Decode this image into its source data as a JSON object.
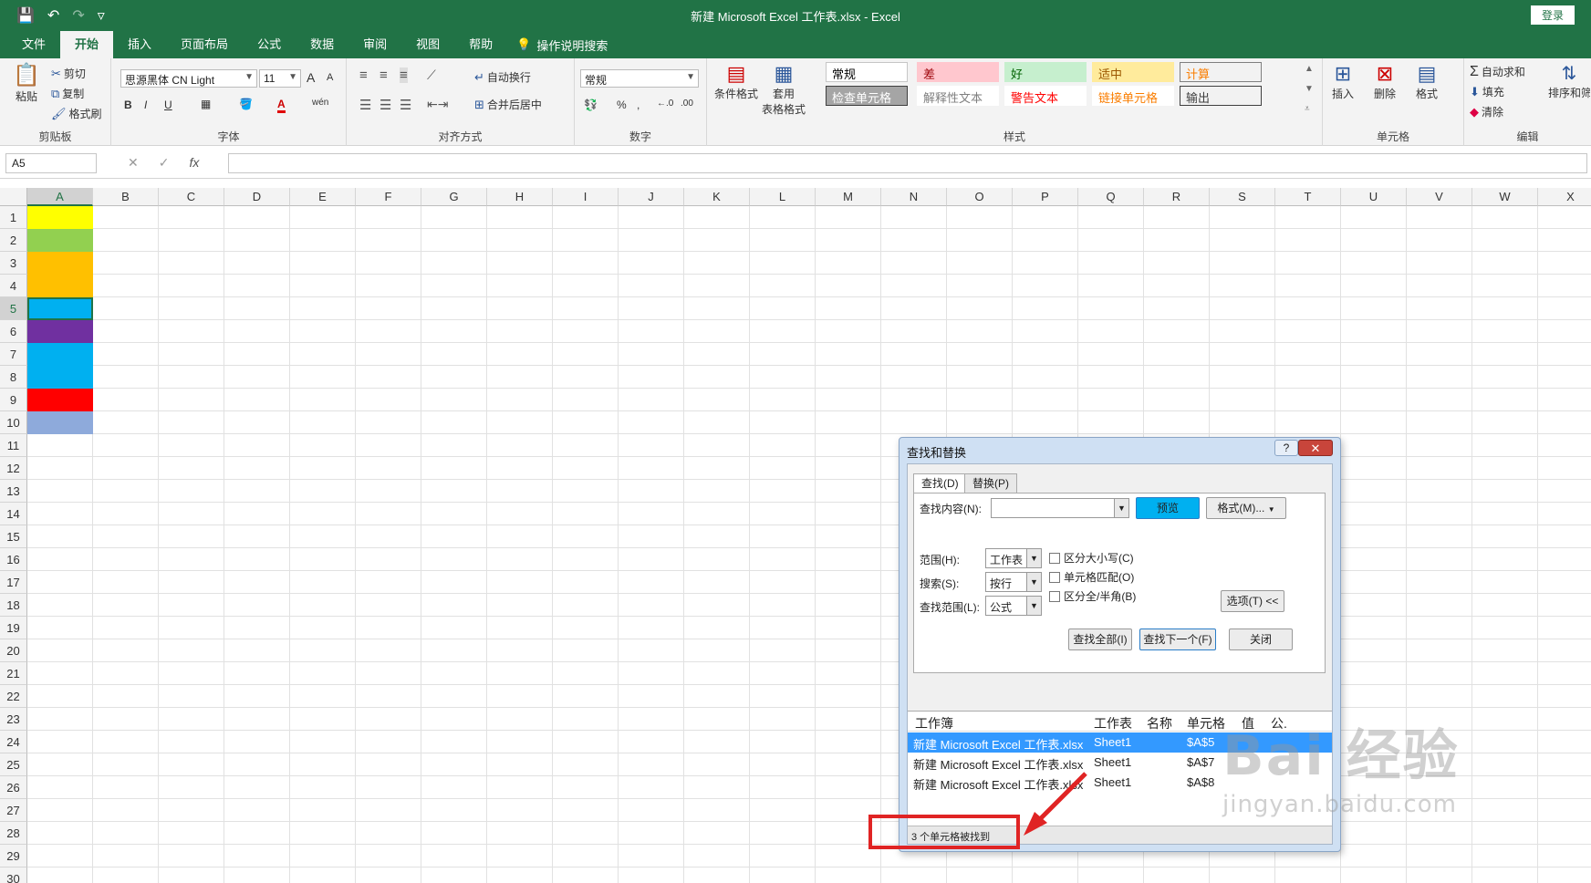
{
  "titlebar": {
    "title": "新建 Microsoft Excel 工作表.xlsx  -  Excel",
    "login": "登录",
    "save_icon": "💾",
    "undo_icon": "↶",
    "redo_icon": "↷",
    "customize_icon": "▿"
  },
  "tabs": [
    "文件",
    "开始",
    "插入",
    "页面布局",
    "公式",
    "数据",
    "审阅",
    "视图",
    "帮助"
  ],
  "tellme": "操作说明搜索",
  "ribbon": {
    "clipboard": {
      "label": "剪贴板",
      "paste": "粘贴",
      "cut": "剪切",
      "copy": "复制",
      "format_painter": "格式刷"
    },
    "font": {
      "label": "字体",
      "name": "思源黑体 CN Light",
      "size": "11",
      "grow": "A",
      "shrink": "A",
      "bold": "B",
      "italic": "I",
      "underline": "U",
      "font_color": "A",
      "phonetic": "wén"
    },
    "alignment": {
      "label": "对齐方式",
      "wrap": "自动换行",
      "merge": "合并后居中"
    },
    "number": {
      "label": "数字",
      "format": "常规",
      "percent": "%",
      "comma": ","
    },
    "styles": {
      "label": "样式",
      "cond_format": "条件格式",
      "table_format_1": "套用",
      "table_format_2": "表格格式",
      "items": [
        {
          "text": "常规",
          "bg": "#ffffff",
          "fg": "#000000",
          "border": "#c6c6c6"
        },
        {
          "text": "差",
          "bg": "#ffc7ce",
          "fg": "#9c0006",
          "border": "#ffc7ce"
        },
        {
          "text": "好",
          "bg": "#c6efce",
          "fg": "#006100",
          "border": "#c6efce"
        },
        {
          "text": "适中",
          "bg": "#ffeb9c",
          "fg": "#9c5700",
          "border": "#ffeb9c"
        },
        {
          "text": "计算",
          "bg": "#f2f2f2",
          "fg": "#fa7d00",
          "border": "#7f7f7f"
        },
        {
          "text": "检查单元格",
          "bg": "#a5a5a5",
          "fg": "#ffffff",
          "border": "#3f3f3f"
        },
        {
          "text": "解释性文本",
          "bg": "#ffffff",
          "fg": "#7f7f7f",
          "border": "#ffffff"
        },
        {
          "text": "警告文本",
          "bg": "#ffffff",
          "fg": "#ff0000",
          "border": "#ffffff"
        },
        {
          "text": "链接单元格",
          "bg": "#ffffff",
          "fg": "#fa7d00",
          "border": "#ffffff"
        },
        {
          "text": "输出",
          "bg": "#f2f2f2",
          "fg": "#3f3f3f",
          "border": "#3f3f3f"
        }
      ]
    },
    "cells": {
      "label": "单元格",
      "insert": "插入",
      "delete": "删除",
      "format": "格式"
    },
    "editing": {
      "label": "编辑",
      "autosum": "自动求和",
      "fill": "填充",
      "clear": "清除",
      "sort": "排序和筛"
    }
  },
  "formula_bar": {
    "name_box": "A5",
    "cancel": "✕",
    "enter": "✓",
    "fx": "fx",
    "value": ""
  },
  "columns": [
    "A",
    "B",
    "C",
    "D",
    "E",
    "F",
    "G",
    "H",
    "I",
    "J",
    "K",
    "L",
    "M",
    "N",
    "O",
    "P",
    "Q",
    "R",
    "S",
    "T",
    "U",
    "V",
    "W",
    "X"
  ],
  "rows": [
    "1",
    "2",
    "3",
    "4",
    "5",
    "6",
    "7",
    "8",
    "9",
    "10",
    "11",
    "12",
    "13",
    "14",
    "15",
    "16",
    "17",
    "18",
    "19",
    "20",
    "21",
    "22",
    "23",
    "24",
    "25",
    "26",
    "27",
    "28",
    "29",
    "30"
  ],
  "column_a_colors": [
    "#ffff00",
    "#92d050",
    "#ffc000",
    "#ffc000",
    "#00b0f0",
    "#7030a0",
    "#00b0f0",
    "#00b0f0",
    "#ff0000",
    "#8eaadb"
  ],
  "selected_cell": "A5",
  "dialog": {
    "title": "查找和替换",
    "help": "?",
    "close": "✕",
    "tab_find": "查找(D)",
    "tab_replace": "替换(P)",
    "find_label": "查找内容(N):",
    "find_value": "",
    "preview": "预览",
    "preview_bg": "#00b0f0",
    "format_btn": "格式(M)...",
    "within_label": "范围(H):",
    "within_value": "工作表",
    "search_label": "搜索(S):",
    "search_value": "按行",
    "lookin_label": "查找范围(L):",
    "lookin_value": "公式",
    "match_case": "区分大小写(C)",
    "match_entire": "单元格匹配(O)",
    "match_byte": "区分全/半角(B)",
    "options_btn": "选项(T) <<",
    "find_all": "查找全部(I)",
    "find_next": "查找下一个(F)",
    "close_btn": "关闭",
    "result_headers": [
      "工作簿",
      "工作表",
      "名称",
      "单元格",
      "值",
      "公."
    ],
    "results": [
      {
        "book": "新建 Microsoft Excel 工作表.xlsx",
        "sheet": "Sheet1",
        "cell": "$A$5"
      },
      {
        "book": "新建 Microsoft Excel 工作表.xlsx",
        "sheet": "Sheet1",
        "cell": "$A$7"
      },
      {
        "book": "新建 Microsoft Excel 工作表.xlsx",
        "sheet": "Sheet1",
        "cell": "$A$8"
      }
    ],
    "status": "3 个单元格被找到"
  },
  "annotation": {
    "color": "#e02424"
  },
  "watermark": {
    "big": "Bai  经验",
    "small": "jingyan.baidu.com"
  }
}
